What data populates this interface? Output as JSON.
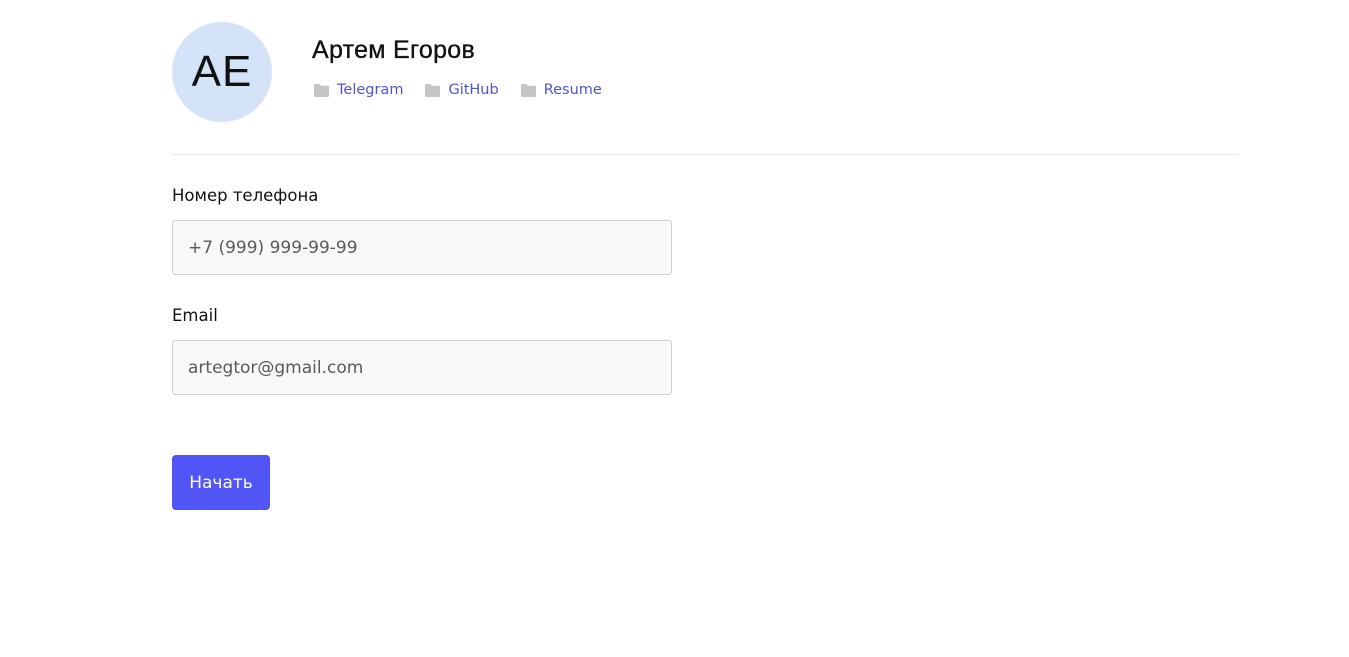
{
  "profile": {
    "initials": "AE",
    "name": "Артем Егоров",
    "links": [
      {
        "label": "Telegram",
        "icon": "folder-icon"
      },
      {
        "label": "GitHub",
        "icon": "folder-icon"
      },
      {
        "label": "Resume",
        "icon": "folder-icon"
      }
    ]
  },
  "form": {
    "phone": {
      "label": "Номер телефона",
      "placeholder": "+7 (999) 999-99-99",
      "value": ""
    },
    "email": {
      "label": "Email",
      "placeholder": "artegtor@gmail.com",
      "value": ""
    },
    "submit_label": "Начать"
  },
  "colors": {
    "accent": "#5255f5",
    "link": "#4f55c9",
    "avatar_bg": "#d4e3f7",
    "icon": "#c4c4c4"
  }
}
